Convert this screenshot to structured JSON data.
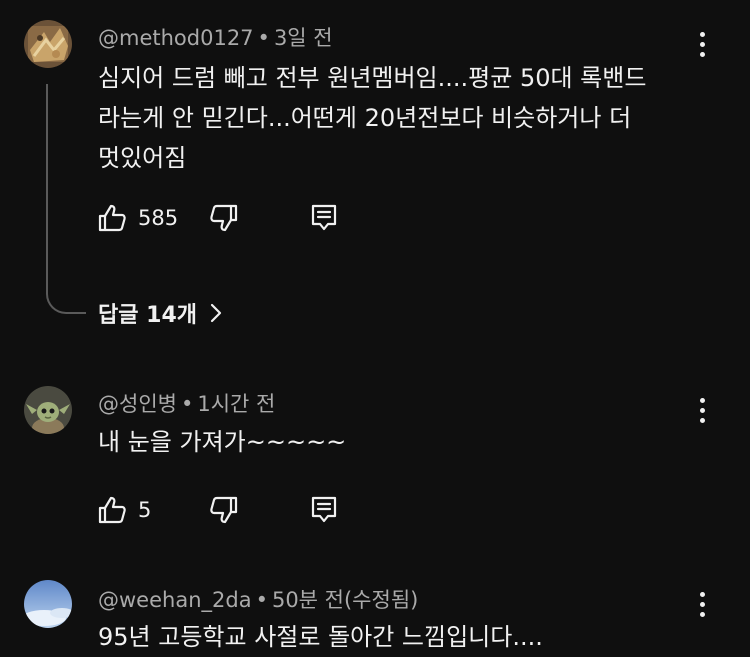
{
  "comments": [
    {
      "author": "@method0127",
      "time": "3일 전",
      "lines": [
        "심지어 드럼 빼고 전부 원년멤버임....평균 50대 록밴드",
        "라는게 안 믿긴다...어떤게 20년전보다 비슷하거나 더",
        "멋있어짐"
      ],
      "likes": "585",
      "replies_label": "답글 14개"
    },
    {
      "author": "@성인병",
      "time": "1시간 전",
      "lines": [
        "내 눈을 가져가~~~~~"
      ],
      "likes": "5"
    },
    {
      "author": "@weehan_2da",
      "time": "50분 전(수정됨)",
      "lines": [
        "95년 고등학교 사절로 돌아간 느낌입니다...."
      ]
    }
  ],
  "icons": {
    "like": "thumbs-up-icon",
    "dislike": "thumbs-down-icon",
    "reply": "reply-comment-icon",
    "more": "more-vertical-icon",
    "chevron": "chevron-right-icon"
  },
  "colors": {
    "background": "#0f0f0f",
    "text": "#f1f1f1",
    "secondary": "#aaaaaa"
  }
}
